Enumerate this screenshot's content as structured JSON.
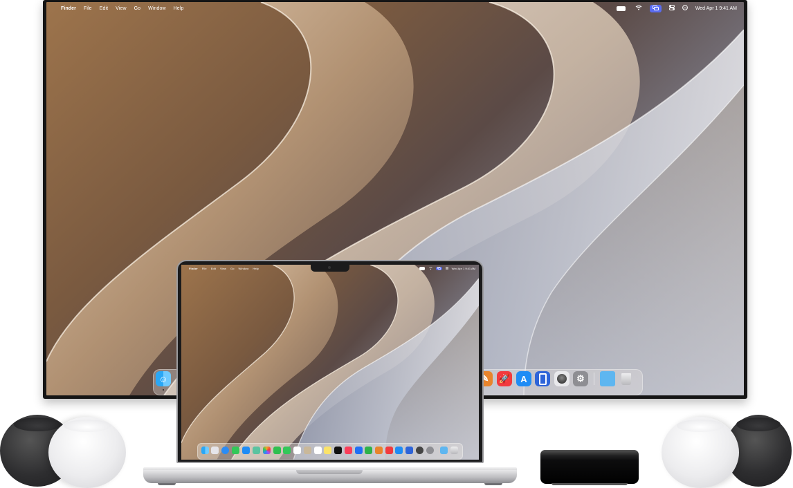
{
  "menubar": {
    "apple_glyph": "",
    "items": [
      "Finder",
      "File",
      "Edit",
      "View",
      "Go",
      "Window",
      "Help"
    ],
    "clock": "Wed Apr 1  9:41 AM",
    "status_icons": [
      "battery-icon",
      "wifi-icon",
      "screen-mirroring-icon",
      "control-center-icon",
      "user-icon"
    ]
  },
  "laptop_menubar": {
    "items": [
      "Finder",
      "File",
      "Edit",
      "View",
      "Go",
      "Window",
      "Help"
    ],
    "clock": "Wed Apr 1  9:41 AM"
  },
  "dock": {
    "left_app": "finder",
    "right_apps": [
      "pages",
      "games",
      "app-store",
      "iphone-mirroring",
      "macos-installer",
      "system-settings",
      "downloads-folder",
      "trash"
    ]
  },
  "colors": {
    "mirroring_active": "#5a6cf0",
    "wallpaper_warm": "#8a6a4c",
    "wallpaper_cool": "#7b8aa6"
  }
}
